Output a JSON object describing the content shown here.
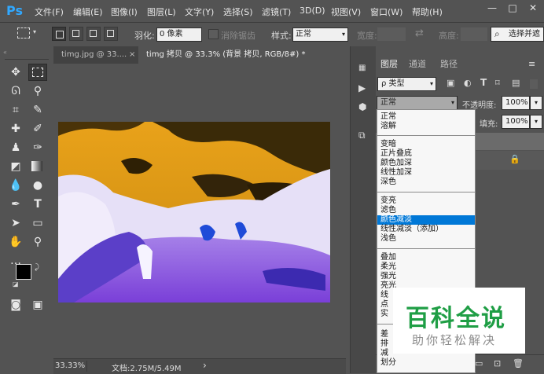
{
  "app": {
    "logo": "Ps"
  },
  "menu": [
    "文件(F)",
    "编辑(E)",
    "图像(I)",
    "图层(L)",
    "文字(Y)",
    "选择(S)",
    "滤镜(T)",
    "3D(D)",
    "视图(V)",
    "窗口(W)",
    "帮助(H)"
  ],
  "window_controls": {
    "minimize": "—",
    "maximize": "□",
    "close": "✕"
  },
  "options": {
    "feather_label": "羽化:",
    "feather_value": "0 像素",
    "antialias_label": "消除锯齿",
    "style_label": "样式:",
    "style_value": "正常",
    "width_label": "宽度:",
    "height_label": "高度:",
    "select_mask_button": "选择并遮"
  },
  "tabs": [
    {
      "label": "timg.jpg @ 33....",
      "close": "×"
    },
    {
      "label": "timg 拷贝 @ 33.3% (背景 拷贝, RGB/8#) *",
      "close": "×"
    }
  ],
  "status": {
    "zoom": "33.33%",
    "doc": "文档:2.75M/5.49M",
    "arrow": "›"
  },
  "layers_panel": {
    "tabs": [
      "图层",
      "通道",
      "路径"
    ],
    "kind_filter": "ρ 类型",
    "blend_mode": "正常",
    "opacity_label": "不透明度:",
    "opacity_value": "100%",
    "fill_label": "填充:",
    "fill_value": "100%"
  },
  "blend_dropdown": {
    "groups": [
      [
        "正常",
        "溶解"
      ],
      [
        "变暗",
        "正片叠底",
        "颜色加深",
        "线性加深",
        "深色"
      ],
      [
        "变亮",
        "滤色",
        "颜色减淡",
        "线性减淡（添加）",
        "浅色"
      ],
      [
        "叠加",
        "柔光",
        "强光",
        "亮光",
        "线",
        "点",
        "实"
      ],
      [
        "差",
        "排",
        "减",
        "划分"
      ]
    ],
    "highlighted": "颜色减淡"
  },
  "watermark": {
    "title": "百科全说",
    "subtitle": "助你轻松解决"
  },
  "colors": {
    "ui_bg": "#535353",
    "highlight": "#0078d7",
    "watermark_green": "#1f9e45",
    "ps_blue": "#31a8ff"
  }
}
